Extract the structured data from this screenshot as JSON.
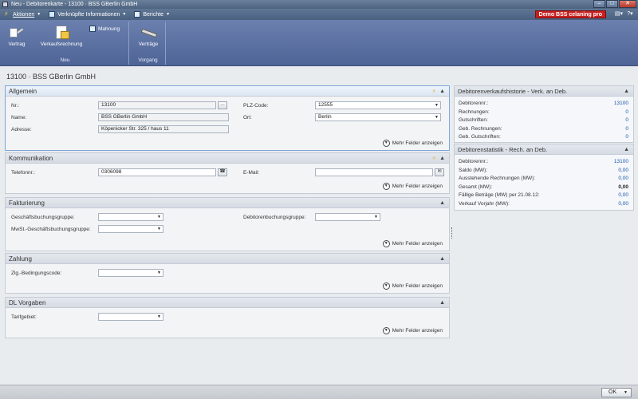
{
  "window": {
    "title": "Neu - Debitorenkarte - 13100 · BSS GBerlin GmbH"
  },
  "menubar": {
    "items": [
      {
        "label": "Aktionen",
        "icon": "bolt-icon"
      },
      {
        "label": "Verknüpfte Informationen",
        "icon": "links-icon"
      },
      {
        "label": "Berichte",
        "icon": "report-icon"
      }
    ],
    "demo_badge": "Demo BSS celaning pro",
    "right_icons": [
      "views-icon",
      "help-icon"
    ]
  },
  "ribbon": {
    "groups": [
      {
        "label": "Neu",
        "buttons": [
          {
            "label": "Vertrag",
            "icon": "contract-pen-icon"
          },
          {
            "label": "Verkaufsrechnung",
            "icon": "sales-invoice-icon"
          },
          {
            "label": "Mahnung",
            "icon": "reminder-icon"
          }
        ]
      },
      {
        "label": "Vorgang",
        "buttons": [
          {
            "label": "Verträge",
            "icon": "contracts-icon"
          }
        ]
      }
    ]
  },
  "page": {
    "title": "13100 · BSS GBerlin GmbH"
  },
  "tabs": {
    "allgemein": {
      "title": "Allgemein",
      "nr_label": "Nr.:",
      "nr_value": "13100",
      "name_label": "Name:",
      "name_value": "BSS GBerlin GmbH",
      "adresse_label": "Adresse:",
      "adresse_value": "Köpenicker Str. 325 / haus 11",
      "plz_label": "PLZ-Code:",
      "plz_value": "12555",
      "ort_label": "Ort:",
      "ort_value": "Berlin",
      "more": "Mehr Felder anzeigen"
    },
    "kommunikation": {
      "title": "Kommunikation",
      "telefon_label": "Telefonnr.:",
      "telefon_value": "0306098",
      "email_label": "E-Mail:",
      "email_value": "",
      "more": "Mehr Felder anzeigen"
    },
    "fakturierung": {
      "title": "Fakturierung",
      "gbg_label": "Geschäftsbuchungsgruppe:",
      "gbg_value": "",
      "mwst_label": "MwSt.-Geschäftsbuchungsgruppe:",
      "mwst_value": "",
      "dbg_label": "Debitorenbuchungsgruppe:",
      "dbg_value": "",
      "more": "Mehr Felder anzeigen"
    },
    "zahlung": {
      "title": "Zahlung",
      "zlg_label": "Zlg.-Bedingungscode:",
      "zlg_value": "",
      "more": "Mehr Felder anzeigen"
    },
    "dl": {
      "title": "DL Vorgaben",
      "tarif_label": "Tarifgebiet:",
      "tarif_value": "",
      "more": "Mehr Felder anzeigen"
    }
  },
  "factboxes": {
    "history": {
      "title": "Debitorenverkaufshistorie - Verk. an Deb.",
      "rows": [
        {
          "label": "Debitorennr.:",
          "value": "13100"
        },
        {
          "label": "Rechnungen:",
          "value": "0"
        },
        {
          "label": "Gutschriften:",
          "value": "0"
        },
        {
          "label": "Geb. Rechnungen:",
          "value": "0"
        },
        {
          "label": "Geb. Gutschriften:",
          "value": "0"
        }
      ]
    },
    "stats": {
      "title": "Debitorenstatistik - Rech. an Deb.",
      "rows": [
        {
          "label": "Debitorennr.:",
          "value": "13100"
        },
        {
          "label": "Saldo (MW):",
          "value": "0,00"
        },
        {
          "label": "Ausstehende Rechnungen (MW):",
          "value": "0,00"
        },
        {
          "label": "Gesamt (MW):",
          "value": "0,00"
        },
        {
          "label": "Fällige Beträge (MW) per 21.08.12:",
          "value": "0,00"
        },
        {
          "label": "Verkauf Vorjahr (MW):",
          "value": "0,00"
        }
      ]
    }
  },
  "statusbar": {
    "ok_label": "OK"
  }
}
